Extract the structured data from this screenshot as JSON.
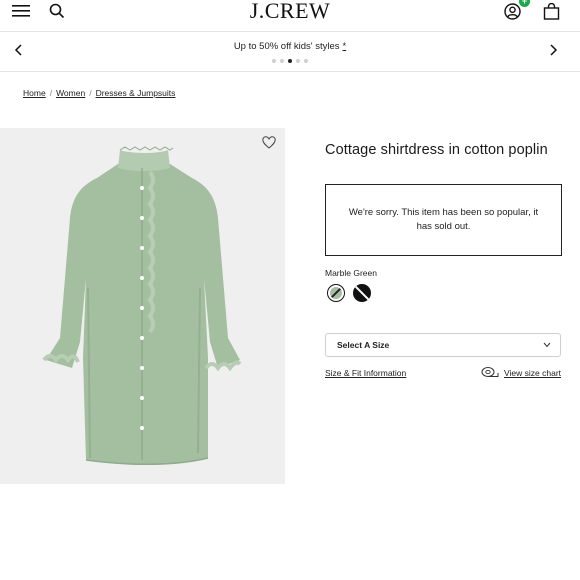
{
  "header": {
    "logo": "J.CREW",
    "cart_count": "+"
  },
  "promo": {
    "text": "Up to 50% off kids' styles",
    "star": "*",
    "dots": 5,
    "active_dot": 3
  },
  "breadcrumb": {
    "items": [
      "Home",
      "Women",
      "Dresses & Jumpsuits"
    ],
    "separator": "/"
  },
  "product": {
    "title": "Cottage shirtdress in cotton poplin",
    "soldout_message": "We're sorry. This item has been so popular, it has sold out.",
    "color_label": "Marble Green",
    "swatches": [
      {
        "name": "Marble Green",
        "color": "#a9bca6",
        "selected": true
      },
      {
        "name": "Black",
        "color": "#111111",
        "selected": false
      }
    ],
    "size_select_label": "Select A Size",
    "size_fit_link": "Size & Fit Information",
    "size_chart_link": "View size chart"
  },
  "colors": {
    "badge": "#19a94a",
    "dress": "#a3bfa0",
    "image_bg": "#efefef"
  }
}
